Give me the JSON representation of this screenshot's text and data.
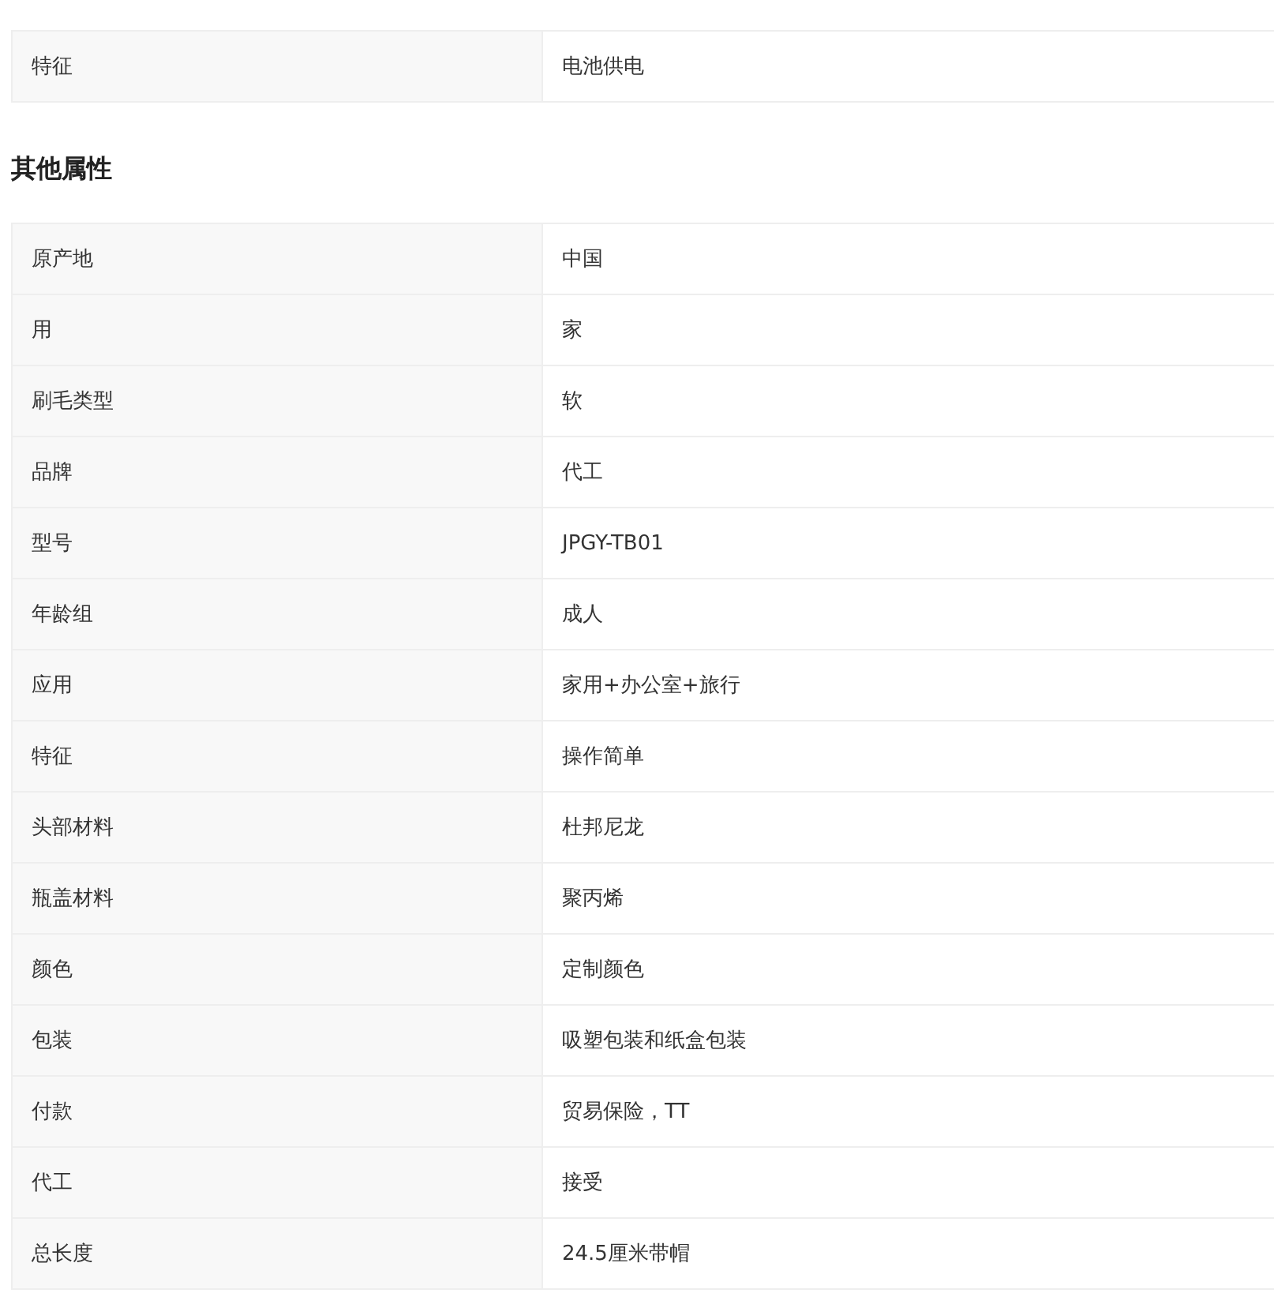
{
  "top_table": {
    "rows": [
      {
        "label": "特征",
        "value": "电池供电"
      }
    ]
  },
  "section": {
    "title": "其他属性",
    "rows": [
      {
        "label": "原产地",
        "value": "中国"
      },
      {
        "label": "用",
        "value": "家"
      },
      {
        "label": "刷毛类型",
        "value": "软"
      },
      {
        "label": "品牌",
        "value": "代工"
      },
      {
        "label": "型号",
        "value": "JPGY-TB01"
      },
      {
        "label": "年龄组",
        "value": "成人"
      },
      {
        "label": "应用",
        "value": "家用+办公室+旅行"
      },
      {
        "label": "特征",
        "value": "操作简单"
      },
      {
        "label": "头部材料",
        "value": "杜邦尼龙"
      },
      {
        "label": "瓶盖材料",
        "value": "聚丙烯"
      },
      {
        "label": "颜色",
        "value": "定制颜色"
      },
      {
        "label": "包装",
        "value": "吸塑包装和纸盒包装"
      },
      {
        "label": "付款",
        "value": "贸易保险，TT"
      },
      {
        "label": "代工",
        "value": "接受"
      },
      {
        "label": "总长度",
        "value": "24.5厘米带帽"
      }
    ]
  }
}
